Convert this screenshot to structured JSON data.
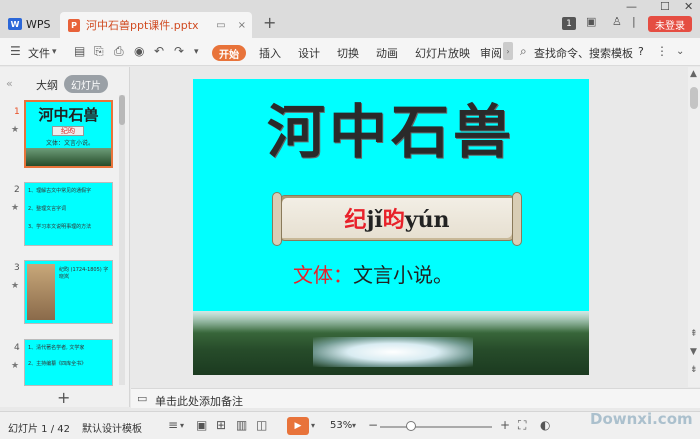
{
  "titlebar": {
    "app_name": "WPS",
    "doc_tab_title": "河中石兽ppt课件.pptx",
    "login_label": "未登录",
    "page_badge": "1"
  },
  "toolbar": {
    "file_menu": "文件",
    "tabs": [
      "开始",
      "插入",
      "设计",
      "切换",
      "动画",
      "幻灯片放映",
      "审阅"
    ],
    "search_label": "查找命令、搜索模板",
    "help": "?"
  },
  "left_panel": {
    "outline_tab": "大纲",
    "slides_tab": "幻灯片",
    "thumbnails": [
      {
        "num": "1",
        "title": "河中石兽",
        "sub": "纪昀",
        "line": "文体：文言小说。"
      },
      {
        "num": "2",
        "line1": "1、理解古文中常见的通假字",
        "line2": "2、整理文言字词",
        "line3": "3、学习本文说明事理的方法"
      },
      {
        "num": "3",
        "caption": "纪昀 (1724-1805) 字晓岚"
      },
      {
        "num": "4",
        "line1": "1、清代著名学者, 文学家",
        "line2": "2、主持编纂《四库全书》"
      }
    ]
  },
  "slide": {
    "title": "河中石兽",
    "banner_red": "纪",
    "banner_mid": "jǐ",
    "banner_red2": "昀",
    "banner_end": "yún",
    "genre_label": "文体：",
    "genre_value": "文言小说。"
  },
  "notes": {
    "placeholder": "单击此处添加备注"
  },
  "statusbar": {
    "slide_counter": "幻灯片 1 / 42",
    "template": "默认设计模板",
    "zoom": "53%",
    "zoom_minus": "−",
    "zoom_plus": "+",
    "watermark": "Downxi.com"
  }
}
